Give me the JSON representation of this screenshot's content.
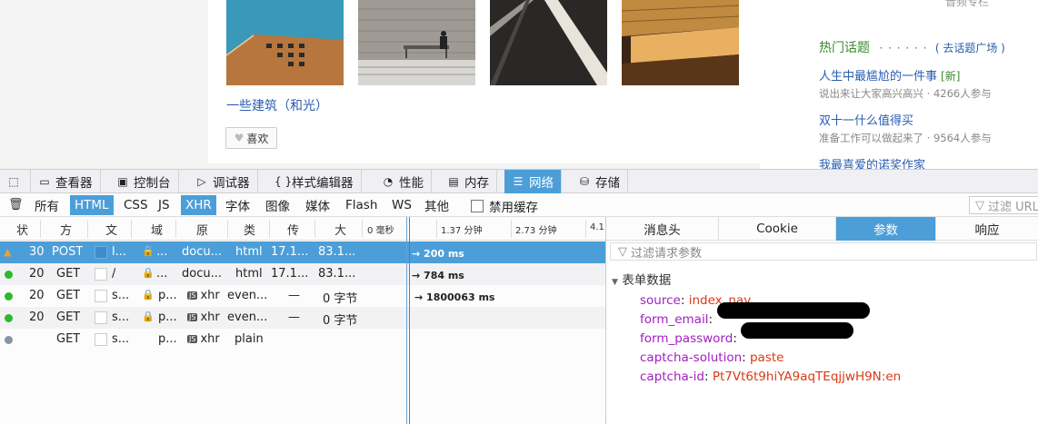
{
  "page": {
    "album_title": "一些建筑（和光）",
    "like_label": "喜欢",
    "sidebar_cut_text": "音频专栏",
    "hot_title": "热门话题",
    "hot_dots": "· · · · · ·",
    "hot_more": "( 去话题广场 )",
    "topics": [
      {
        "title": "人生中最尴尬的一件事",
        "badge": "[新]",
        "sub": "说出来让大家高兴高兴 · 4266人参与"
      },
      {
        "title": "双十一什么值得买",
        "badge": "",
        "sub": "准备工作可以做起来了 · 9564人参与"
      },
      {
        "title": "我最喜爱的诺奖作家",
        "badge": "",
        "sub": ""
      }
    ]
  },
  "devtools": {
    "tabs": [
      {
        "label": "查看器",
        "icon": "inspector-icon"
      },
      {
        "label": "控制台",
        "icon": "console-icon"
      },
      {
        "label": "调试器",
        "icon": "debugger-icon"
      },
      {
        "label": "样式编辑器",
        "icon": "style-editor-icon"
      },
      {
        "label": "性能",
        "icon": "performance-icon"
      },
      {
        "label": "内存",
        "icon": "memory-icon"
      },
      {
        "label": "网络",
        "icon": "network-icon"
      },
      {
        "label": "存储",
        "icon": "storage-icon"
      }
    ],
    "active_tab": "网络",
    "filters": [
      "所有",
      "HTML",
      "CSS",
      "JS",
      "XHR",
      "字体",
      "图像",
      "媒体",
      "Flash",
      "WS",
      "其他"
    ],
    "active_filters": [
      "HTML",
      "XHR"
    ],
    "disable_cache_label": "禁用缓存",
    "url_filter_placeholder": "过滤 URL",
    "columns": [
      "状",
      "方",
      "文",
      "域",
      "原",
      "类",
      "传",
      "大"
    ],
    "timeline_ticks": [
      "0 毫秒",
      "1.37 分钟",
      "2.73 分钟",
      "4.1"
    ],
    "requests": [
      {
        "status": "30",
        "method": "POST",
        "file": "l...",
        "domain": "...",
        "cause": "docu...",
        "type": "html",
        "transferred": "17.1...",
        "size": "83.1...",
        "timing": "→ 200 ms",
        "state": "warning"
      },
      {
        "status": "20",
        "method": "GET",
        "file": "/",
        "domain": "...",
        "cause": "docu...",
        "type": "html",
        "transferred": "17.1...",
        "size": "83.1...",
        "timing": "→ 784 ms",
        "state": "ok"
      },
      {
        "status": "20",
        "method": "GET",
        "file": "s...",
        "domain": "p...",
        "cause": "xhr",
        "type": "even...",
        "transferred": "—",
        "size": "0 字节",
        "timing": "→ 1800063 ms",
        "state": "ok"
      },
      {
        "status": "20",
        "method": "GET",
        "file": "s...",
        "domain": "p...",
        "cause": "xhr",
        "type": "even...",
        "transferred": "—",
        "size": "0 字节",
        "timing": "",
        "state": "ok"
      },
      {
        "status": "",
        "method": "GET",
        "file": "s...",
        "domain": "p...",
        "cause": "xhr",
        "type": "plain",
        "transferred": "",
        "size": "",
        "timing": "",
        "state": "pending"
      }
    ],
    "side_tabs": [
      "消息头",
      "Cookie",
      "参数",
      "响应"
    ],
    "active_side_tab": "参数",
    "param_filter_placeholder": "过滤请求参数",
    "form_section": "表单数据",
    "form_data": [
      {
        "key": "source",
        "value": "index_nav"
      },
      {
        "key": "form_email",
        "value": ""
      },
      {
        "key": "form_password",
        "value": ""
      },
      {
        "key": "captcha-solution",
        "value": "paste"
      },
      {
        "key": "captcha-id",
        "value": "Pt7Vt6t9hiYA9aqTEqjjwH9N:en"
      }
    ]
  },
  "colors": {
    "accent": "#4c9ed9",
    "link": "#2a5db0",
    "green": "#3a8a2e",
    "param_key": "#a020c0",
    "param_value": "#d83a14"
  }
}
